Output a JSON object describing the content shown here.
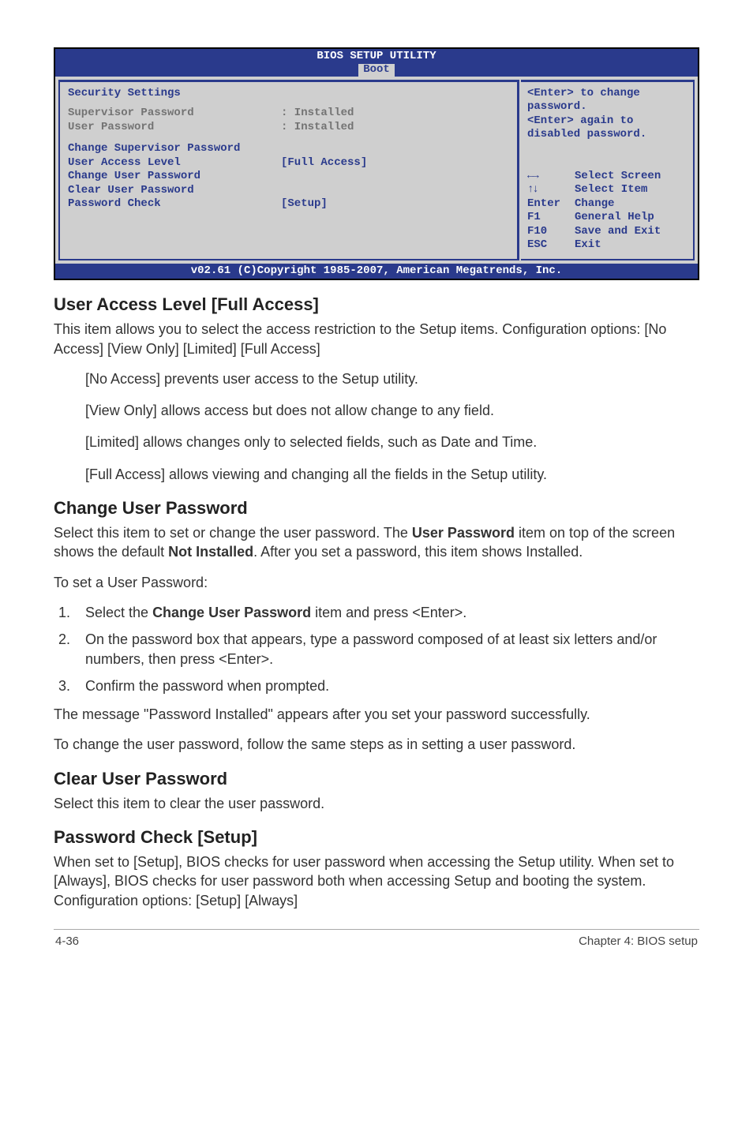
{
  "bios": {
    "title": "BIOS SETUP UTILITY",
    "tab": "Boot",
    "left": {
      "heading": "Security Settings",
      "supervisor_label": "Supervisor Password",
      "supervisor_value": ": Installed",
      "user_label": "User Password",
      "user_value": ": Installed",
      "change_supervisor": "Change Supervisor Password",
      "user_access_label": "User Access Level",
      "user_access_value": "[Full Access]",
      "change_user": "Change User Password",
      "clear_user": "Clear User Password",
      "password_check_label": "Password Check",
      "password_check_value": "[Setup]"
    },
    "right": {
      "help1": "<Enter> to change password.",
      "help2": "<Enter> again to disabled password.",
      "k_lr": "Select Screen",
      "k_ud": "Select Item",
      "k_enter_label": "Enter",
      "k_enter": "Change",
      "k_f1_label": "F1",
      "k_f1": "General Help",
      "k_f10_label": "F10",
      "k_f10": "Save and Exit",
      "k_esc_label": "ESC",
      "k_esc": "Exit"
    },
    "footer": "v02.61 (C)Copyright 1985-2007, American Megatrends, Inc."
  },
  "doc": {
    "h_user_access": "User Access Level [Full Access]",
    "p_user_access_1": "This item allows you to select the access restriction to the Setup items. Configuration options: [No Access] [View Only] [Limited] [Full Access]",
    "p_no_access": "[No Access] prevents user access to the Setup utility.",
    "p_view_only": "[View Only] allows access but does not allow change to any field.",
    "p_limited": "[Limited] allows changes only to selected fields, such as Date and Time.",
    "p_full_access": "[Full Access] allows viewing and changing all the fields in the Setup utility.",
    "h_change_user": "Change User Password",
    "p_change_user_1a": "Select this item to set or change the user password. The ",
    "p_change_user_1b": "User Password",
    "p_change_user_1c": " item on top of the screen shows the default ",
    "p_change_user_1d": "Not Installed",
    "p_change_user_1e": ". After you set a password, this item shows Installed.",
    "p_to_set": "To set a User Password:",
    "li1a": "Select the ",
    "li1b": "Change User Password",
    "li1c": " item and press <Enter>.",
    "li2": "On the password box that appears, type a password composed of at least six letters and/or numbers, then press <Enter>.",
    "li3": "Confirm the password when prompted.",
    "p_installed_msg": "The message \"Password Installed\" appears after you set your password successfully.",
    "p_to_change": "To change the user password, follow the same steps as in setting a user password.",
    "h_clear_user": "Clear User Password",
    "p_clear_user": "Select this item to clear the user password.",
    "h_pwd_check": "Password Check [Setup]",
    "p_pwd_check": "When set to [Setup], BIOS checks for user password when accessing the Setup utility. When set to [Always], BIOS checks for user password both when accessing Setup and booting the system. Configuration options: [Setup] [Always]"
  },
  "footer": {
    "left": "4-36",
    "right": "Chapter 4: BIOS setup"
  }
}
